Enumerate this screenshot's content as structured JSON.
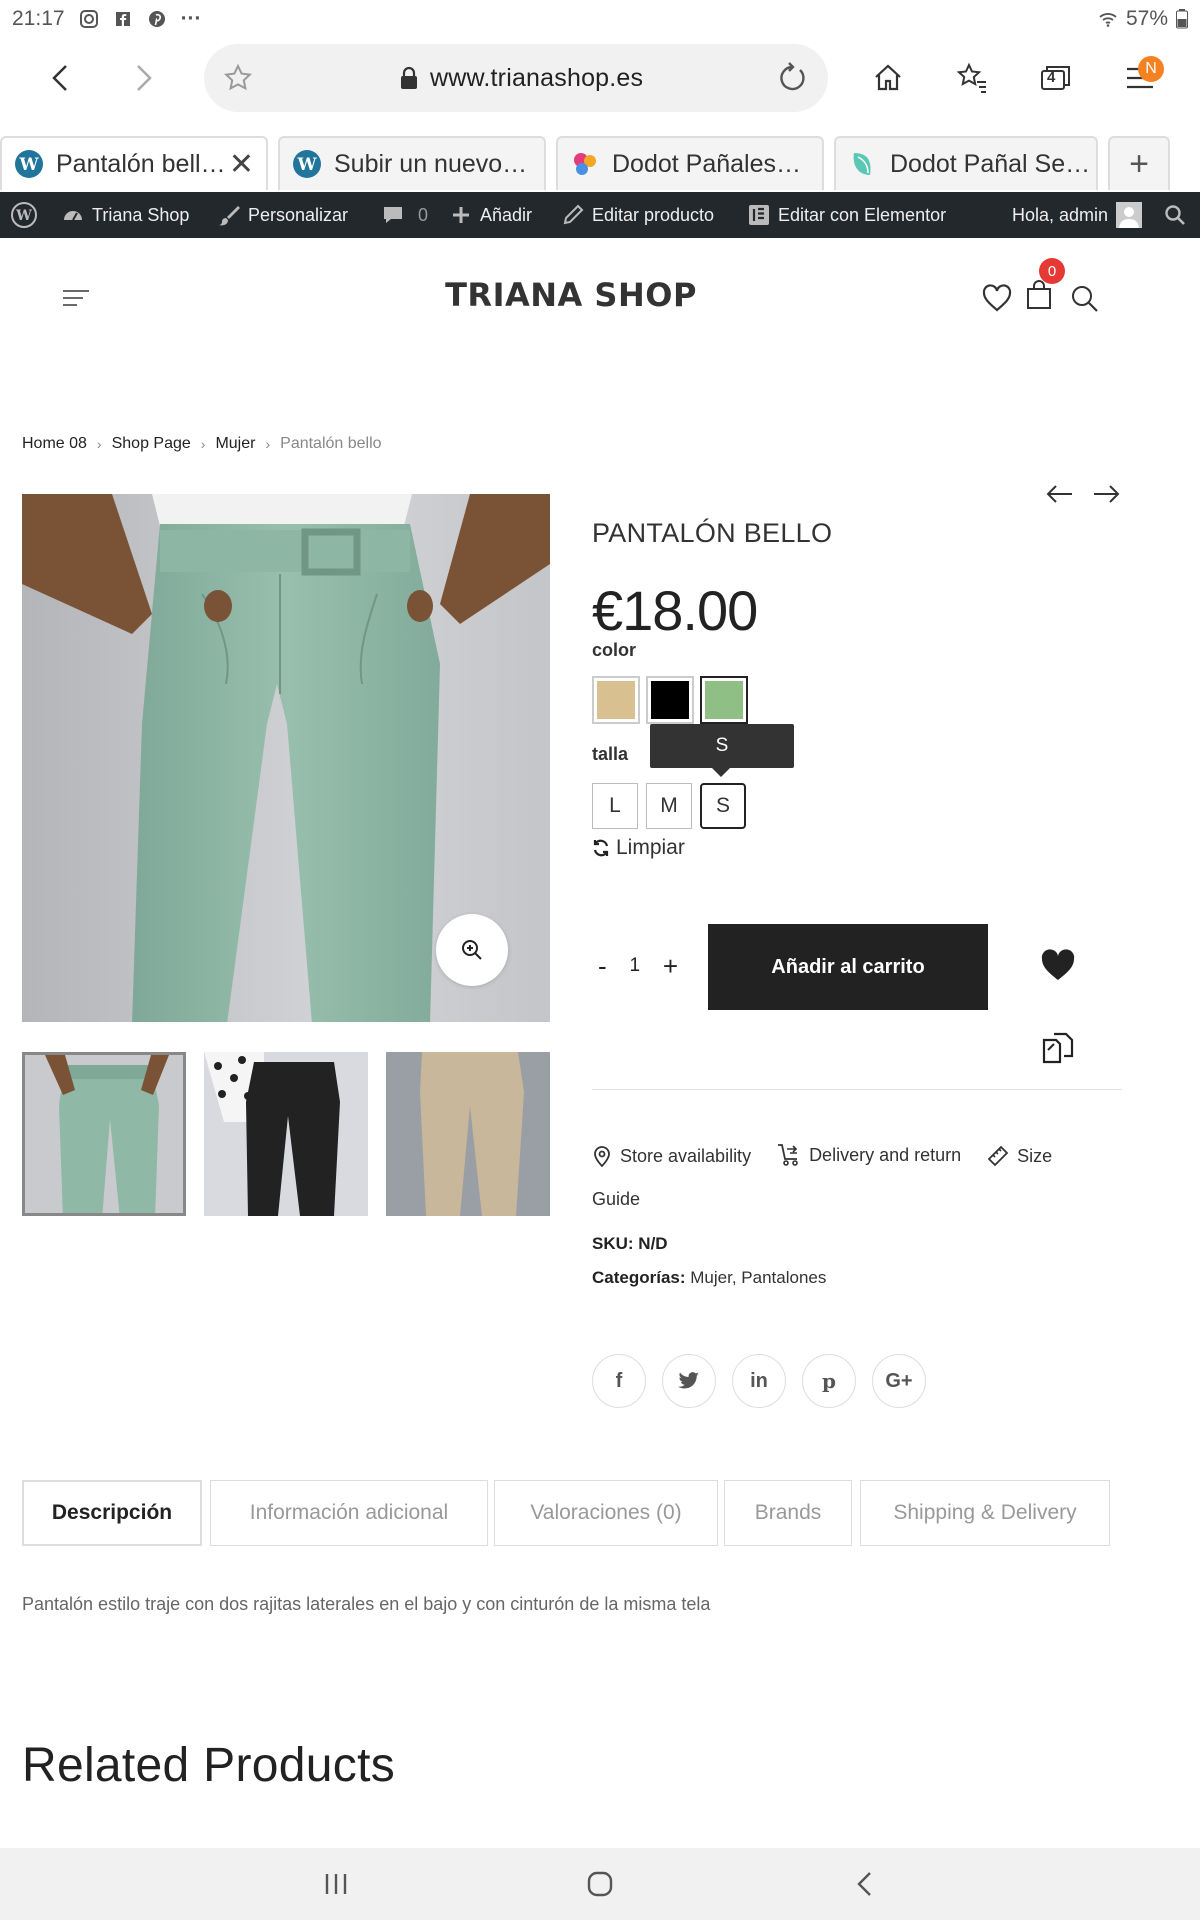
{
  "status_bar": {
    "time": "21:17",
    "battery": "57%",
    "more": "···"
  },
  "browser": {
    "url": "www.trianashop.es",
    "badge": "N",
    "tab_count": "4"
  },
  "tabs": [
    {
      "title": "Pantalón bell…",
      "active": true
    },
    {
      "title": "Subir un nuevo…",
      "active": false
    },
    {
      "title": "Dodot Pañales…",
      "active": false
    },
    {
      "title": "Dodot Pañal Se…",
      "active": false
    }
  ],
  "adminbar": {
    "site": "Triana Shop",
    "customize": "Personalizar",
    "comments": "0",
    "add": "Añadir",
    "edit_product": "Editar producto",
    "elementor": "Editar con Elementor",
    "greeting": "Hola, admin"
  },
  "site": {
    "logo": "TRIANA SHOP",
    "cart_count": "0"
  },
  "breadcrumb": [
    "Home 08",
    "Shop Page",
    "Mujer",
    "Pantalón bello"
  ],
  "product": {
    "title": "PANTALÓN BELLO",
    "price": "€18.00",
    "color_label": "color",
    "colors": [
      "#d8c091",
      "#000000",
      "#8fbf84"
    ],
    "size_label": "talla",
    "sizes": [
      "L",
      "M",
      "S"
    ],
    "selected_size": "S",
    "tooltip": "S",
    "clear": "Limpiar",
    "quantity": "1",
    "qty_minus": "-",
    "qty_plus": "+",
    "add_to_cart": "Añadir al carrito",
    "links": {
      "store": "Store availability",
      "delivery": "Delivery and return",
      "size": "Size",
      "size_guide": "Guide"
    },
    "sku_label": "SKU:",
    "sku_value": "N/D",
    "cat_label": "Categorías:",
    "categories": "Mujer, Pantalones",
    "social": [
      "f",
      "t",
      "in",
      "p",
      "G+"
    ]
  },
  "product_tabs": [
    "Descripción",
    "Información adicional",
    "Valoraciones (0)",
    "Brands",
    "Shipping & Delivery"
  ],
  "description": "Pantalón estilo traje con dos rajitas laterales en el bajo y con cinturón de la misma tela",
  "related_heading": "Related Products"
}
